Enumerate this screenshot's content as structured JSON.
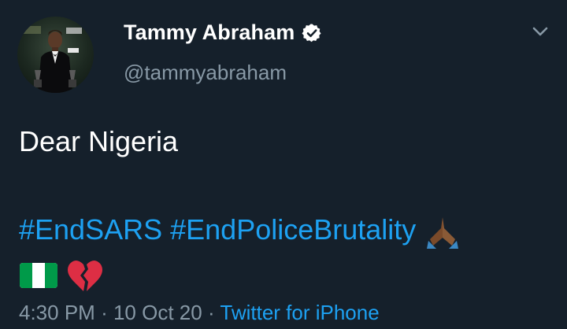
{
  "tweet": {
    "author": {
      "display_name": "Tammy Abraham",
      "handle": "@tammyabraham",
      "verified": true,
      "avatar": "profile-photo"
    },
    "text_line1": "Dear Nigeria",
    "hashtags": [
      "#EndSARS",
      "#EndPoliceBrutality"
    ],
    "emojis": [
      "folded-hands",
      "nigeria-flag",
      "broken-heart"
    ],
    "time": "4:30 PM",
    "separator": "·",
    "date": "10 Oct 20",
    "source": "Twitter for iPhone"
  },
  "icons": {
    "menu": "chevron-down-icon",
    "verified": "verified-badge-icon"
  },
  "colors": {
    "background": "#15202b",
    "text": "#ffffff",
    "secondary": "#8899a6",
    "link": "#1da1f2"
  }
}
